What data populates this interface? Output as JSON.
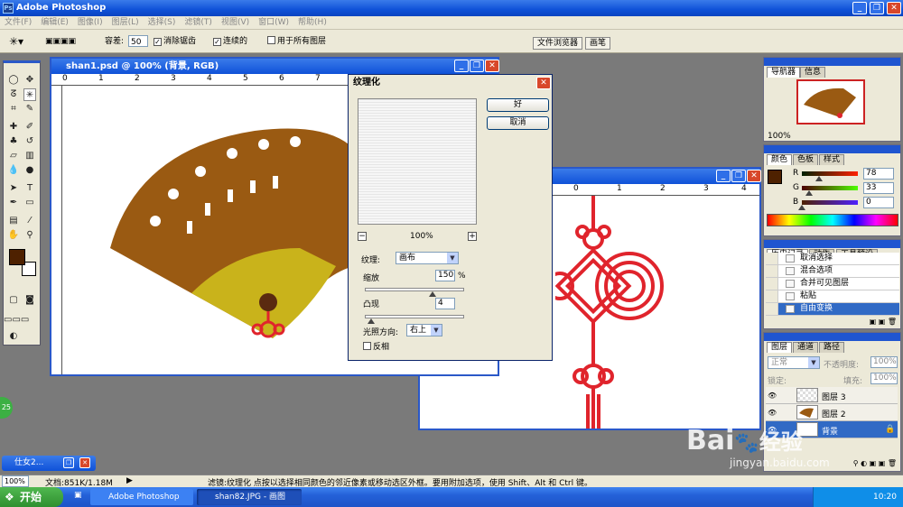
{
  "app": {
    "title": "Adobe Photoshop"
  },
  "menu": [
    "文件(F)",
    "编辑(E)",
    "图像(I)",
    "图层(L)",
    "选择(S)",
    "滤镜(T)",
    "视图(V)",
    "窗口(W)",
    "帮助(H)"
  ],
  "options": {
    "tolerance_label": "容差:",
    "tolerance_value": "50",
    "antialias_label": "消除锯齿",
    "contiguous_label": "连续的",
    "all_layers_label": "用于所有图层",
    "tab_file_browser": "文件浏览器",
    "tab_brushes": "画笔"
  },
  "doc1": {
    "title": "shan1.psd @ 100% (背景, RGB)",
    "ruler_ticks": [
      "0",
      "1",
      "2",
      "3",
      "4",
      "5",
      "6",
      "7",
      "8",
      "9",
      "10",
      "11"
    ]
  },
  "doc2": {
    "ruler_ticks": [
      "0",
      "1",
      "2",
      "3",
      "4",
      "5",
      "6",
      "7",
      "8",
      "9",
      "10"
    ]
  },
  "dialog": {
    "title": "纹理化",
    "ok_label": "好",
    "cancel_label": "取消",
    "zoom": "100%",
    "texture_label": "纹理:",
    "texture_value": "画布",
    "scale_label": "缩放",
    "scale_value": "150",
    "scale_unit": "%",
    "relief_label": "凸现",
    "relief_value": "4",
    "light_label": "光照方向:",
    "light_value": "右上",
    "invert_label": "反相"
  },
  "navigator": {
    "tab1": "导航器",
    "tab2": "信息",
    "zoom": "100%"
  },
  "color": {
    "tab1": "颜色",
    "tab2": "色板",
    "tab3": "样式",
    "r_label": "R",
    "g_label": "G",
    "b_label": "B",
    "r_value": "78",
    "g_value": "33",
    "b_value": "0",
    "r": 78,
    "g": 33,
    "b": 0
  },
  "history": {
    "tab1": "历史记录",
    "tab2": "动作",
    "tab3": "工具预设",
    "items": [
      "取消选择",
      "混合选项",
      "合并可见图层",
      "粘贴",
      "自由变换"
    ]
  },
  "layers": {
    "tab1": "图层",
    "tab2": "通道",
    "tab3": "路径",
    "mode": "正常",
    "opacity_label": "不透明度:",
    "opacity_value": "100%",
    "lock_label": "锁定:",
    "fill_label": "填充:",
    "fill_value": "100%",
    "items": [
      "图层 3",
      "图层 2",
      "背景"
    ]
  },
  "minimized": {
    "title": "仕女2..."
  },
  "status": {
    "zoom": "100%",
    "doc_info": "文档:851K/1.18M",
    "hint": "滤镜:纹理化  点按以选择相同颜色的邻近像素或移动选区外框。要用附加选项，使用 Shift、Alt 和 Ctrl 键。"
  },
  "taskbar": {
    "start": "开始",
    "task1": "Adobe Photoshop",
    "task2": "shan82.JPG - 画图",
    "clock": "10:20"
  },
  "badge": "25",
  "watermark": {
    "brand": "Bai",
    "brand2": "经验",
    "url": "jingyan.baidu.com"
  },
  "colors": {
    "fg_swatch": "#4e2100",
    "knot_red": "#e0242c",
    "fan_brown": "#9a5a12"
  }
}
